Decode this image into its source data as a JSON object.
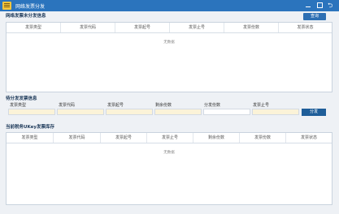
{
  "window": {
    "title": "网络发票分发",
    "restore_glyph": "⮌"
  },
  "section1": {
    "title": "网络发票未分发信息",
    "query_label": "查询",
    "columns": [
      "发票类型",
      "发票代码",
      "发票起号",
      "发票止号",
      "发票份数",
      "发票状态"
    ],
    "empty_text": "无数据"
  },
  "form": {
    "title": "待分发发票信息",
    "labels": [
      "发票类型",
      "发票代码",
      "发票起号",
      "剩余份数",
      "分发份数",
      "发票止号"
    ],
    "values": [
      "",
      "",
      "",
      "",
      "",
      ""
    ],
    "split_label": "分发"
  },
  "section3": {
    "title": "当前税务UKey发票库存",
    "columns": [
      "发票类型",
      "发票代码",
      "发票起号",
      "发票止号",
      "剩余份数",
      "发票份数",
      "发票状态"
    ],
    "empty_text": "无数据"
  },
  "colors": {
    "titlebar": "#2b74bd",
    "accent_button": "#2d6fb3",
    "input_highlight": "#fbf3d8"
  }
}
